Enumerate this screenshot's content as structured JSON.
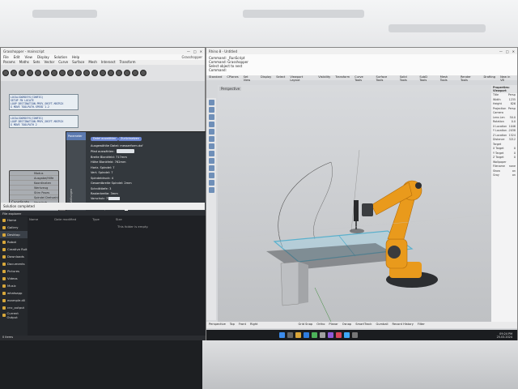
{
  "grasshopper": {
    "title": "Grasshopper - mainscript",
    "menu": [
      "File",
      "Edit",
      "View",
      "Display",
      "Solution",
      "Help"
    ],
    "menu_right": "Grasshopper",
    "tabs": [
      "Params",
      "Maths",
      "Sets",
      "Vector",
      "Curve",
      "Surface",
      "Mesh",
      "Intersect",
      "Transform"
    ],
    "code_block_1": "LOCALCOORDSYS(CONFIG)\nSETUP FN LOCATE\nLOOP DESTINATION.PREV_SHIFT.MATRIX\nG MOVE TOOLPATH.SPEED 1.2",
    "code_block_2": "LOCALCOORDSYS(CONFIG)\nLOOP DESTINATION.PREV_SHIFT.MATRIX\nG MOVE TOOLPATH 2",
    "component_label": "Coordinate",
    "component_rows": [
      "Modus",
      "Ausgabe/Hilfe",
      "Koordinaten",
      "Werkzeug",
      "Stirn Poses",
      "Spindel Drehzahl",
      "Vorschub",
      "Parameter",
      "Pfad",
      "Zeit",
      "Simulation"
    ],
    "component_footer": "CNC Laser",
    "dialog": {
      "side_tab": "Parameter",
      "side_vertical": "Einstellungen",
      "button_1": "Datei auswählen",
      "button_2": "Zurücksetzen",
      "lines": [
        "Ausgewählte Datei: messerform.dxf",
        "Pfad auswählen:",
        "Breite Blankfeld: 717mm",
        "Höhe Blankfeld: 762mm",
        "Horiz. Spindel: 7",
        "Vert. Spindel: 7",
        "Spindeldruck: 4",
        "Gesamtbreite Spindel: 2mm",
        "Schnitttiefe: 3",
        "Rasterbreite: 3mm",
        "Vorschub: 75",
        "Werkzeugwechsel aktiviert:",
        "Laser für präzise Kanten:"
      ],
      "button_red": "Datei entfernen",
      "button_3": "Simulation Start",
      "button_4": "KRL exportieren"
    },
    "status": "Solution completed"
  },
  "explorer": {
    "title": "File explorer",
    "columns": [
      "Name",
      "Date modified",
      "Type",
      "Size"
    ],
    "empty_message": "This folder is empty.",
    "sidebar": [
      "Home",
      "Gallery",
      "Desktop",
      "Robot",
      "Creative Ruit",
      "Downloads",
      "Documents",
      "Pictures",
      "Videos",
      "Music",
      "whatsapp",
      "example.dll",
      "cnc_output",
      "Current Output"
    ],
    "status": "0 items"
  },
  "rhino": {
    "title": "Rhino 8 - Untitled",
    "command_lines": [
      "Command: _RunScript",
      "Command: Grasshopper",
      "Select object to nest",
      "Command:"
    ],
    "tabs": [
      "Standard",
      "CPlanes",
      "Set View",
      "Display",
      "Select",
      "Viewport Layout",
      "Visibility",
      "Transform",
      "Curve Tools",
      "Surface Tools",
      "Solid Tools",
      "SubD Tools",
      "Mesh Tools",
      "Render Tools",
      "Drafting",
      "New in V8"
    ],
    "viewport_label": "Perspective",
    "bottom_tabs": [
      "Perspective",
      "Top",
      "Front",
      "Right"
    ],
    "properties": {
      "header": "Properties: Viewport",
      "rows": [
        [
          "Title",
          "Persp"
        ],
        [
          "Width",
          "1235"
        ],
        [
          "Height",
          "826"
        ],
        [
          "Projection",
          "Persp"
        ],
        [
          "Camera",
          ""
        ],
        [
          "Lens Len",
          "50.0"
        ],
        [
          "Rotation",
          "0.0"
        ],
        [
          "X Location",
          "1046"
        ],
        [
          "Y Location",
          "-2038"
        ],
        [
          "Z Location",
          "1524"
        ],
        [
          "Distance",
          "3212"
        ],
        [
          "Target",
          ""
        ],
        [
          "X Target",
          "0"
        ],
        [
          "Y Target",
          "0"
        ],
        [
          "Z Target",
          "0"
        ],
        [
          "Wallpaper",
          ""
        ],
        [
          "Filename",
          "none"
        ],
        [
          "Show",
          "on"
        ],
        [
          "Gray",
          "on"
        ]
      ]
    },
    "status": [
      "Grid Snap",
      "Ortho",
      "Planar",
      "Osnap",
      "SmartTrack",
      "Gumball",
      "Record History",
      "Filter"
    ],
    "clock_time": "09:24 PM",
    "clock_date": "25.03.2024"
  },
  "colors": {
    "robot_orange": "#e99a1c",
    "dialog_bg": "#33383d",
    "accent_blue": "#6b85d0"
  }
}
